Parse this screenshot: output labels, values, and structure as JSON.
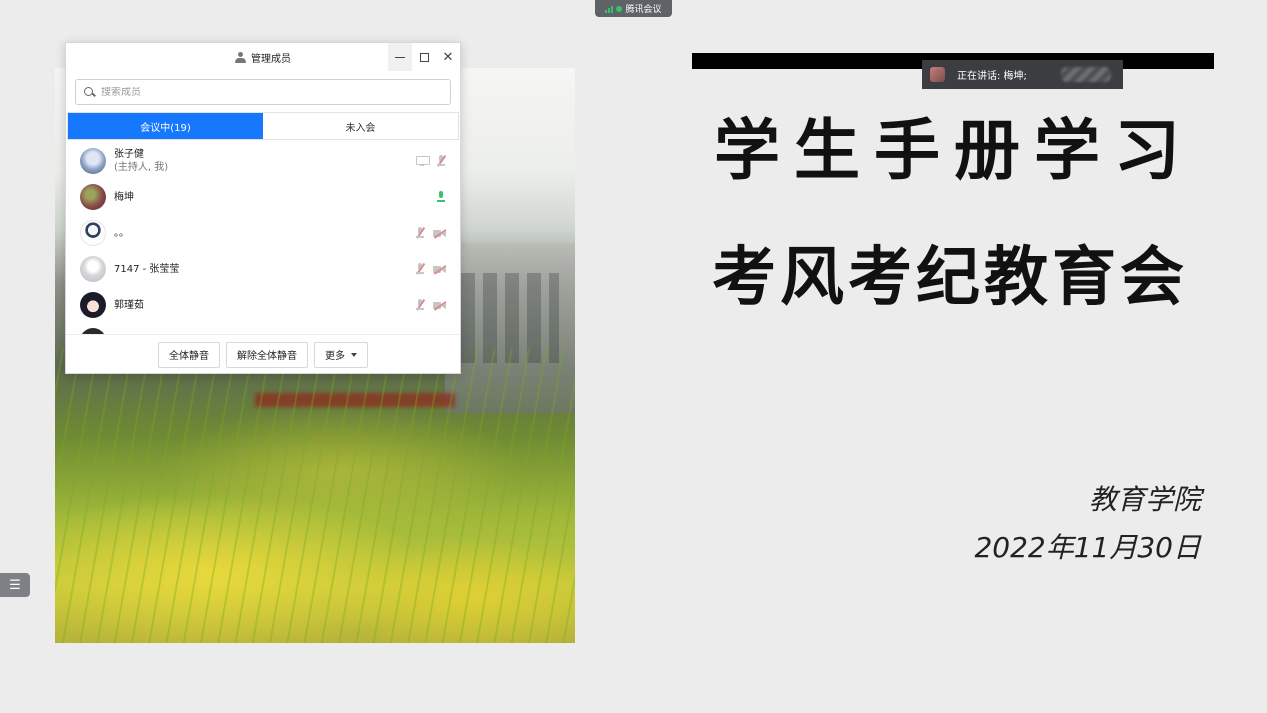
{
  "top_pill": {
    "label": "腾讯会议"
  },
  "slide": {
    "title_line1": "学生手册学习",
    "title_line2": "考风考纪教育会",
    "org": "教育学院",
    "date": "2022年11月30日"
  },
  "speaker": {
    "text": "正在讲话: 梅坤;"
  },
  "side_tab": {
    "icon": "list-icon"
  },
  "members_panel": {
    "title": "管理成员",
    "search_placeholder": "搜索成员",
    "tabs": [
      {
        "label": "会议中(19)",
        "active": true
      },
      {
        "label": "未入会",
        "active": false
      }
    ],
    "members": [
      {
        "name": "张子健",
        "sub": "(主持人, 我)",
        "icons": [
          "screen-share-icon",
          "mic-off-icon"
        ]
      },
      {
        "name": "梅坤",
        "sub": "",
        "icons": [
          "mic-on-icon"
        ]
      },
      {
        "name": "。。",
        "sub": "",
        "icons": [
          "mic-off-icon",
          "camera-off-icon"
        ]
      },
      {
        "name": "7147 - 张莹莹",
        "sub": "",
        "icons": [
          "mic-off-icon",
          "camera-off-icon"
        ]
      },
      {
        "name": "郭瑾茹",
        "sub": "",
        "icons": [
          "mic-off-icon",
          "camera-off-icon"
        ]
      }
    ],
    "footer": {
      "mute_all": "全体静音",
      "unmute_all": "解除全体静音",
      "more": "更多"
    }
  }
}
